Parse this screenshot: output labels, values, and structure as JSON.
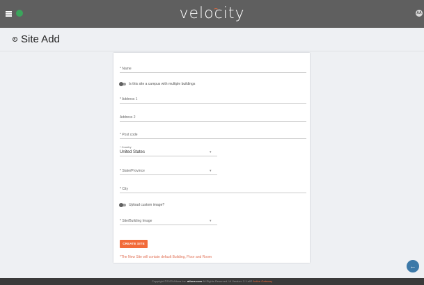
{
  "header": {
    "logo_text": "velocity",
    "avatar_initials": "AA"
  },
  "page": {
    "title": "Site Add"
  },
  "form": {
    "name_label": "* Name",
    "campus_toggle_label": "Is this site a campus with multiple buildings",
    "address1_label": "* Address 1",
    "address2_label": "Address 2",
    "postcode_label": "* Post code",
    "country_label": "* Country",
    "country_value": "United States",
    "state_label": "* State/Province",
    "city_label": "* City",
    "upload_toggle_label": "Upload custom image?",
    "image_label": "* Site/Building Image",
    "create_button": "CREATE SITE",
    "note": "*The New Site will contain default Building, Floor and Room"
  },
  "footer": {
    "copyright": "Copyright ©2023 Atlona Inc.",
    "link": "atlona.com",
    "rights": "All Rights Reserved. UI Version: 2.1.a02",
    "status": "Active Gateway"
  },
  "colors": {
    "accent": "#f26b3a",
    "topbar": "#5f5f5f",
    "fab": "#3c79a8"
  }
}
